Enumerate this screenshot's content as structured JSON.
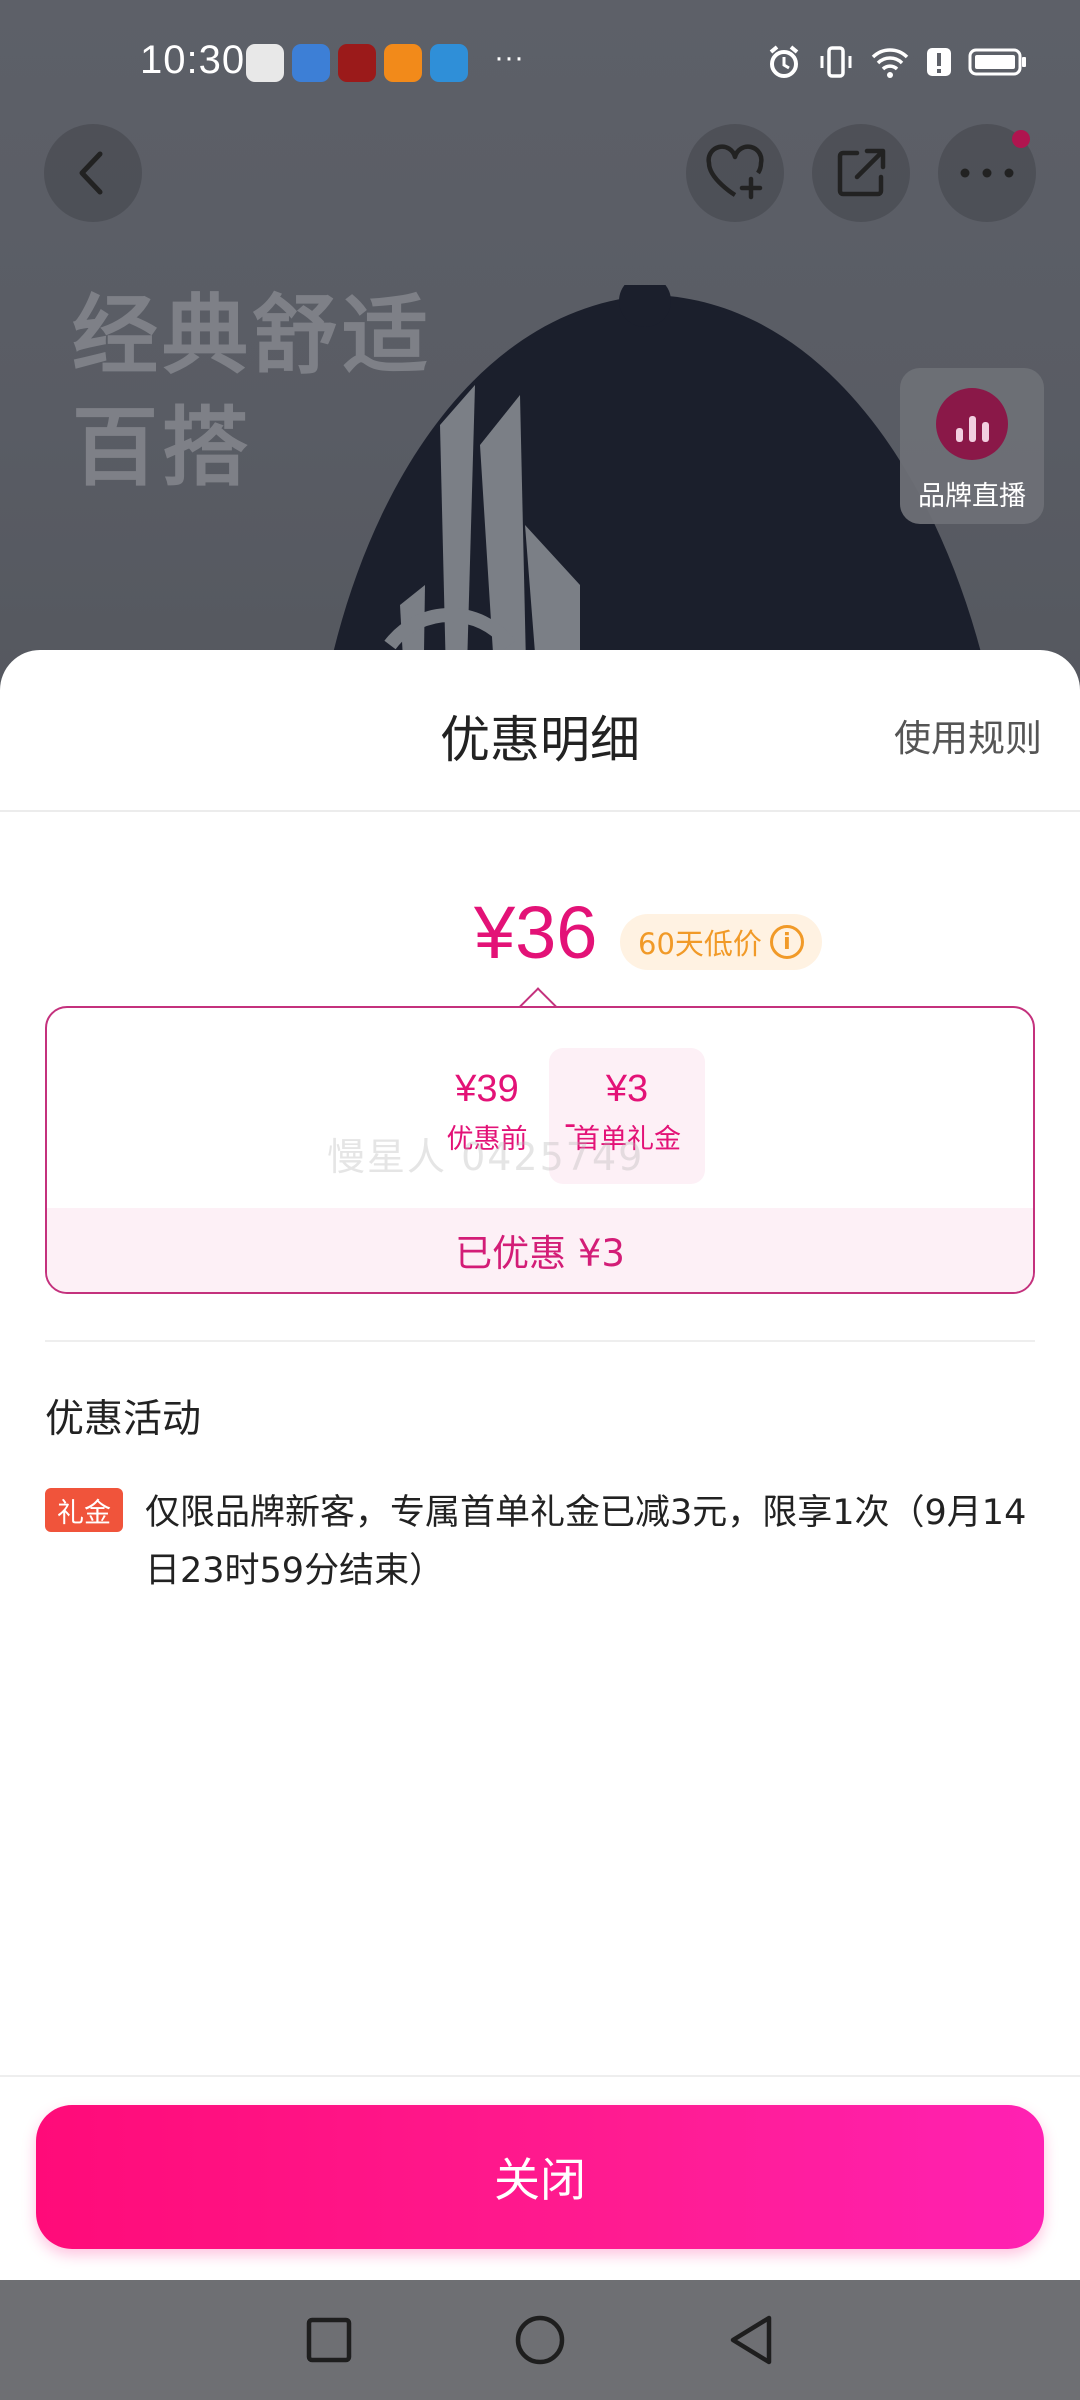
{
  "status_bar": {
    "time": "10:30",
    "more": "···",
    "app_icon_colors": [
      "#e8e8e8",
      "#3d7fd6",
      "#9b1a1a",
      "#f28a1a",
      "#2f8fd8"
    ]
  },
  "background_page": {
    "hero_text_line1": "经典舒适",
    "hero_text_line2": "百搭",
    "live_badge_label": "品牌直播"
  },
  "sheet": {
    "title": "优惠明细",
    "rules_link": "使用规则",
    "final_price": "¥36",
    "low_price_badge": "60天低价",
    "breakdown": {
      "original_value": "¥39",
      "original_label": "优惠前",
      "minus": "-",
      "discount_value": "¥3",
      "discount_label": "首单礼金",
      "watermark": "慢星人 0425749",
      "saved_text": "已优惠 ¥3"
    },
    "activities_title": "优惠活动",
    "activity": {
      "tag": "礼金",
      "text": "仅限品牌新客，专属首单礼金已减3元，限享1次（9月14日23时59分结束）"
    },
    "close_button": "关闭"
  },
  "colors": {
    "accent": "#e31277",
    "button_gradient_start": "#ff0b79",
    "button_gradient_end": "#ff21b3",
    "badge_orange": "#f19a28",
    "tag_red": "#f0543b"
  }
}
